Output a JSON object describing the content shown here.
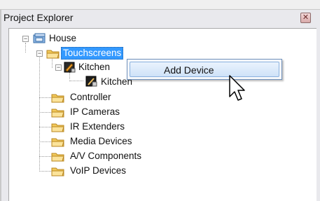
{
  "panel": {
    "title": "Project Explorer",
    "close_symbol": "✕"
  },
  "tree": {
    "root": "House",
    "touchscreens": "Touchscreens",
    "kitchen_group": "Kitchen",
    "kitchen_device": "Kitchen",
    "controller": "Controller",
    "ip_cameras": "IP Cameras",
    "ir_extenders": "IR Extenders",
    "media_devices": "Media Devices",
    "av_components": "A/V Components",
    "voip_devices": "VoIP Devices"
  },
  "context_menu": {
    "add_device": "Add Device"
  },
  "expander": {
    "minus": "−"
  }
}
